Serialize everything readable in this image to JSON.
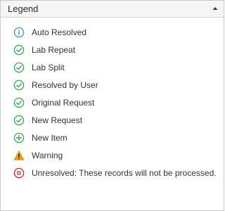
{
  "header": {
    "title": "Legend",
    "collapse_icon": "triangle-up-icon"
  },
  "colors": {
    "info": "#3b8fd4",
    "success": "#33a852",
    "warning": "#f0a020",
    "error": "#c8262e"
  },
  "items": [
    {
      "label": "Auto Resolved",
      "icon": "info-icon"
    },
    {
      "label": "Lab Repeat",
      "icon": "check-circle-icon"
    },
    {
      "label": "Lab Split",
      "icon": "check-circle-icon"
    },
    {
      "label": "Resolved by User",
      "icon": "check-circle-icon"
    },
    {
      "label": "Original Request",
      "icon": "check-circle-icon"
    },
    {
      "label": "New Request",
      "icon": "check-circle-icon"
    },
    {
      "label": "New Item",
      "icon": "plus-circle-icon"
    },
    {
      "label": "Warning",
      "icon": "warning-triangle-icon"
    },
    {
      "label": "Unresolved: These records will not be processed.",
      "icon": "stop-circle-icon"
    }
  ]
}
